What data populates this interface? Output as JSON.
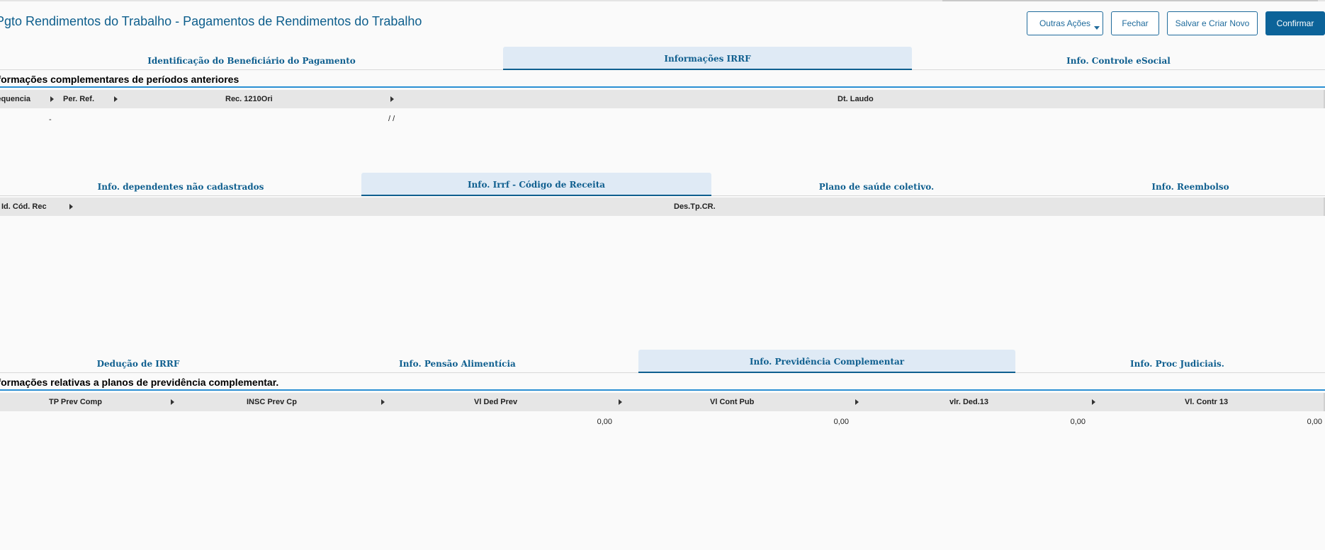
{
  "header": {
    "title": "Pgto Rendimentos do Trabalho - Pagamentos de Rendimentos do Trabalho",
    "buttons": {
      "outras_acoes": "Outras Ações",
      "fechar": "Fechar",
      "salvar_novo": "Salvar e Criar Novo",
      "confirmar": "Confirmar"
    }
  },
  "colors": {
    "accent": "#0c6399",
    "section_line": "#2a8fd3",
    "active_tab_bg": "#dfeaf5"
  },
  "main_tabs": [
    {
      "label": "Identificação do Beneficiário do Pagamento",
      "active": false
    },
    {
      "label": "Informações IRRF",
      "active": true
    },
    {
      "label": "Info. Controle eSocial",
      "active": false
    }
  ],
  "section1": {
    "title": "Informações complementares de períodos anteriores",
    "columns": [
      "Sequencia",
      "Per. Ref.",
      "Rec. 1210Ori",
      "Dt. Laudo"
    ],
    "row": {
      "per_ref": "-",
      "dt_laudo": "/ /"
    }
  },
  "sub_tabs": [
    {
      "label": "Info. dependentes não cadastrados",
      "active": false
    },
    {
      "label": "Info. Irrf - Código de Receita",
      "active": true
    },
    {
      "label": "Plano de saúde coletivo.",
      "active": false
    },
    {
      "label": "Info. Reembolso",
      "active": false
    }
  ],
  "grid2": {
    "columns": [
      "Id. Cód. Rec",
      "Des.Tp.CR."
    ]
  },
  "sub_tabs2": [
    {
      "label": "Dedução de IRRF",
      "active": false
    },
    {
      "label": "Info. Pensão Alimentícia",
      "active": false
    },
    {
      "label": "Info. Previdência Complementar",
      "active": true
    },
    {
      "label": "Info. Proc Judiciais.",
      "active": false
    }
  ],
  "section3": {
    "title": "Informações relativas a planos de previdência complementar.",
    "columns": [
      "TP Prev Comp",
      "INSC Prev Cp",
      "Vl Ded Prev",
      "Vl Cont Pub",
      "vlr. Ded.13",
      "Vl. Contr 13"
    ],
    "row": [
      "0,00",
      "0,00",
      "0,00",
      "0,00"
    ]
  }
}
